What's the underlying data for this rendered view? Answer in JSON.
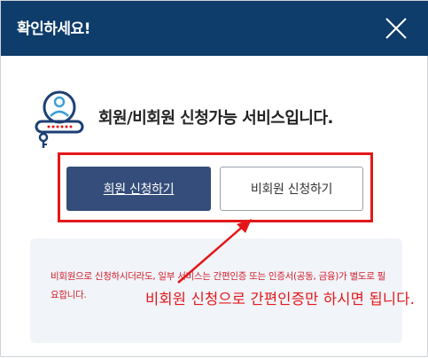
{
  "dialog": {
    "title": "확인하세요!",
    "headline": "회원/비회원 신청가능 서비스입니다."
  },
  "buttons": {
    "member_label": "회원 신청하기",
    "nonmember_label": "비회원 신청하기"
  },
  "notice": {
    "text": "비회원으로 신청하시더라도, 일부 서비스는 간편인증 또는 인증서(공동, 금융)가 별도로 필요합니다."
  },
  "annotation": {
    "text": "비회원 신청으로 간편인증만 하시면 됩니다."
  },
  "colors": {
    "header_bg": "#0e3c6b",
    "member_button_bg": "#344d7a",
    "highlight_red": "#e3171a",
    "notice_text": "#d3202f"
  }
}
